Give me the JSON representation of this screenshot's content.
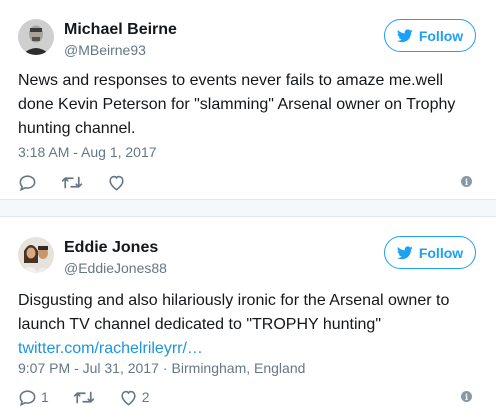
{
  "tweets": [
    {
      "author": "Michael Beirne",
      "handle": "@MBeirne93",
      "follow_label": "Follow",
      "text_lines": [
        "News and responses to events never fails to amaze me.well",
        "done Kevin Peterson for \"slamming\" Arsenal owner on Trophy",
        "hunting channel."
      ],
      "link": "",
      "time": "3:18 AM - Aug 1, 2017",
      "location": "",
      "replies": "",
      "likes": ""
    },
    {
      "author": "Eddie Jones",
      "handle": "@EddieJones88",
      "follow_label": "Follow",
      "text_lines": [
        "Disgusting and also hilariously ironic for the Arsenal owner to",
        "launch TV channel dedicated to \"TROPHY hunting\""
      ],
      "link": "twitter.com/rachelrileyrr/…",
      "time": "9:07 PM - Jul 31, 2017",
      "location": "Birmingham, England",
      "replies": "1",
      "likes": "2"
    }
  ],
  "colors": {
    "accent": "#1da1f2",
    "link": "#1b95e0",
    "muted": "#657786",
    "text": "#14171a"
  },
  "icons": {
    "follow": "twitter-bird-icon",
    "reply": "reply-icon",
    "retweet": "retweet-icon",
    "like": "heart-icon",
    "info": "info-icon"
  }
}
